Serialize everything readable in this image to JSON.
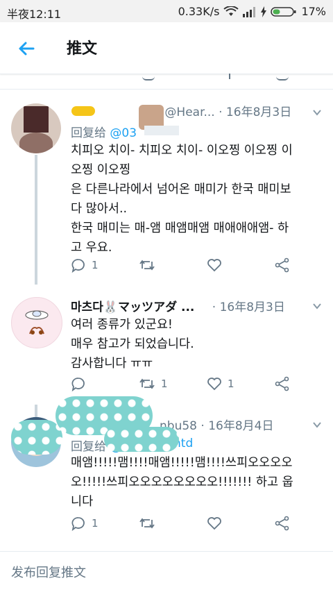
{
  "status_bar": {
    "carrier_time": "半夜12:11",
    "network_speed": "0.33K/s",
    "battery": "17%"
  },
  "app_bar": {
    "title": "推文"
  },
  "tweets": [
    {
      "name": "",
      "handle": "@Hear...",
      "date": "· 16年8月3日",
      "reply_prefix": "回复给",
      "reply_handle": "@03",
      "lines": [
        "치피오 치이- 치피오 치이- 이오찡 이오찡 이",
        "오찡 이오찡",
        "은 다른나라에서 넘어온 매미가 한국 매미보",
        "다 많아서..",
        "한국 매미는 매-앰 매앰매앰 매애애애앰- 하",
        "고 우요."
      ],
      "reply_count": "1",
      "retweet_count": "",
      "like_count": ""
    },
    {
      "name": "마츠다🐰マッツアダ ...",
      "handle": "",
      "date": "· 16年8月3日",
      "lines": [
        "여러 종류가 있군요!",
        "매우 참고가 되었습니다.",
        "감사합니다 ㅠㅠ"
      ],
      "reply_count": "",
      "retweet_count": "1",
      "like_count": "1"
    },
    {
      "name": "",
      "handle": "nbu58 ·",
      "date": "16年8月4日",
      "reply_prefix": "回复给",
      "reply_handle": "@",
      "reply_handle_tail": "ntd",
      "lines": [
        "매앰!!!!!맴!!!!매앰!!!!!맴!!!!쓰피오오오오",
        "오!!!!!쓰피오오오오오오오오!!!!!!! 하고 웁",
        "니다"
      ],
      "reply_count": "1",
      "retweet_count": "",
      "like_count": ""
    }
  ],
  "compose": {
    "placeholder": "发布回复推文"
  },
  "colors": {
    "accent": "#1da1f2",
    "text_secondary": "#657786",
    "divider": "#e6ecf0"
  },
  "icons": [
    "back-arrow-icon",
    "wifi-icon",
    "signal-icon",
    "battery-icon",
    "reply-icon",
    "retweet-icon",
    "like-icon",
    "share-icon",
    "chevron-down-icon"
  ]
}
